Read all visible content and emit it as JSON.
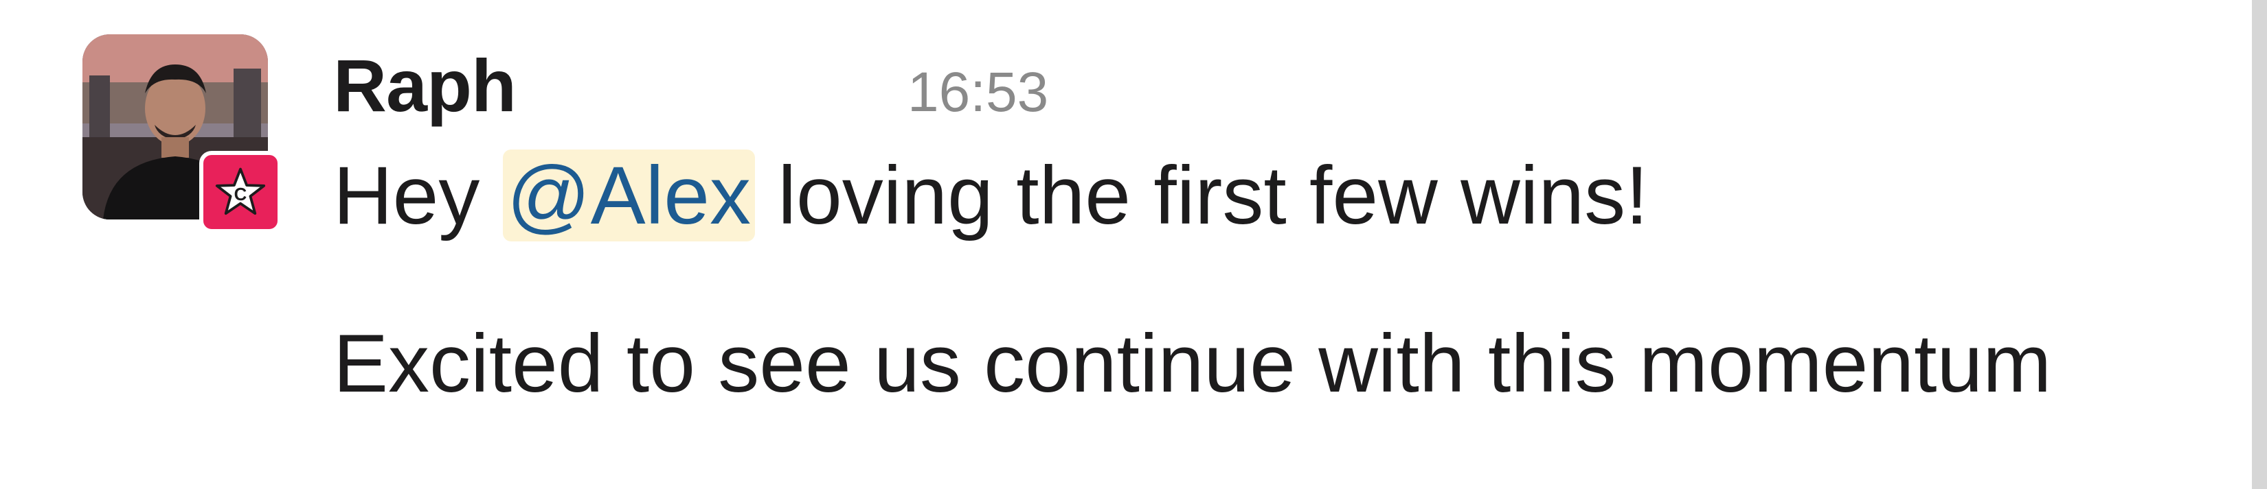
{
  "message": {
    "author": "Raph",
    "timestamp": "16:53",
    "line1_before": "Hey ",
    "mention": "@Alex",
    "line1_after": " loving the first few wins!",
    "line2": "Excited to see us continue with this momentum"
  },
  "avatar": {
    "icon": "user-avatar-photo"
  },
  "badge": {
    "letter": "C",
    "icon": "star-icon",
    "color": "#e8215a"
  },
  "colors": {
    "mention_bg": "#fdf3d4",
    "mention_text": "#1d5b91",
    "timestamp": "#8a8a8a",
    "text": "#1d1c1d"
  }
}
